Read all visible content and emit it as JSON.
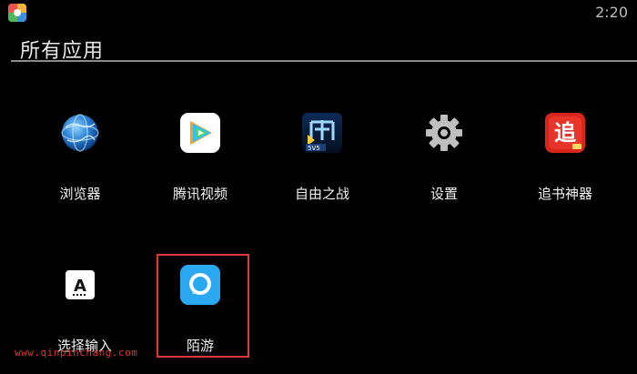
{
  "status_bar": {
    "time": "2:20",
    "app_icon": "app-store-icon"
  },
  "header": {
    "title": "所有应用"
  },
  "apps": [
    {
      "label": "浏览器",
      "icon": "globe-icon"
    },
    {
      "label": "腾讯视频",
      "icon": "video-play-icon"
    },
    {
      "label": "自由之战",
      "icon": "game-icon"
    },
    {
      "label": "设置",
      "icon": "gear-icon"
    },
    {
      "label": "追书神器",
      "icon": "book-icon"
    },
    {
      "label": "选择输入法",
      "icon": "keyboard-a-icon"
    },
    {
      "label": "陌游",
      "icon": "chat-bubble-icon"
    }
  ],
  "selected_app": "陌游",
  "watermark": "www.qinpinchang.com",
  "colors": {
    "background": "#000000",
    "selection_border": "#e53935",
    "watermark": "#e0332e"
  }
}
